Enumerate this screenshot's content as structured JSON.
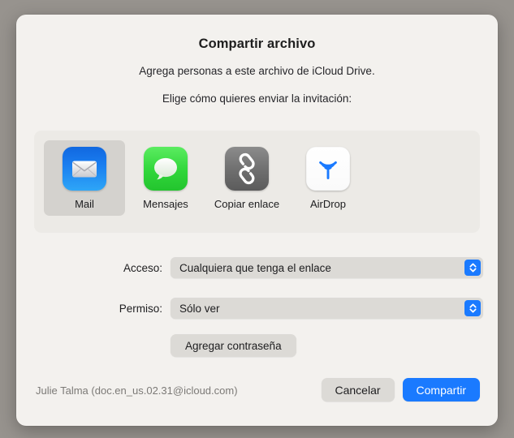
{
  "dialog": {
    "title": "Compartir archivo",
    "subtitle": "Agrega personas a este archivo de iCloud Drive.",
    "prompt": "Elige cómo quieres enviar la invitación:"
  },
  "share_methods": [
    {
      "id": "mail",
      "label": "Mail",
      "icon": "mail-icon",
      "selected": true
    },
    {
      "id": "messages",
      "label": "Mensajes",
      "icon": "messages-icon",
      "selected": false
    },
    {
      "id": "copy-link",
      "label": "Copiar enlace",
      "icon": "link-icon",
      "selected": false
    },
    {
      "id": "airdrop",
      "label": "AirDrop",
      "icon": "airdrop-icon",
      "selected": false
    }
  ],
  "fields": {
    "access": {
      "label": "Acceso:",
      "value": "Cualquiera que tenga el enlace"
    },
    "permission": {
      "label": "Permiso:",
      "value": "Sólo ver"
    }
  },
  "add_password_label": "Agregar contraseña",
  "footer": {
    "account": "Julie Talma (doc.en_us.02.31@icloud.com)",
    "cancel_label": "Cancelar",
    "share_label": "Compartir"
  },
  "colors": {
    "accent": "#1a7aff",
    "window_background": "#f3f1ee",
    "backdrop": "#97938e",
    "control_background": "#dcdad6",
    "selected_method": "#d4d2ce"
  }
}
